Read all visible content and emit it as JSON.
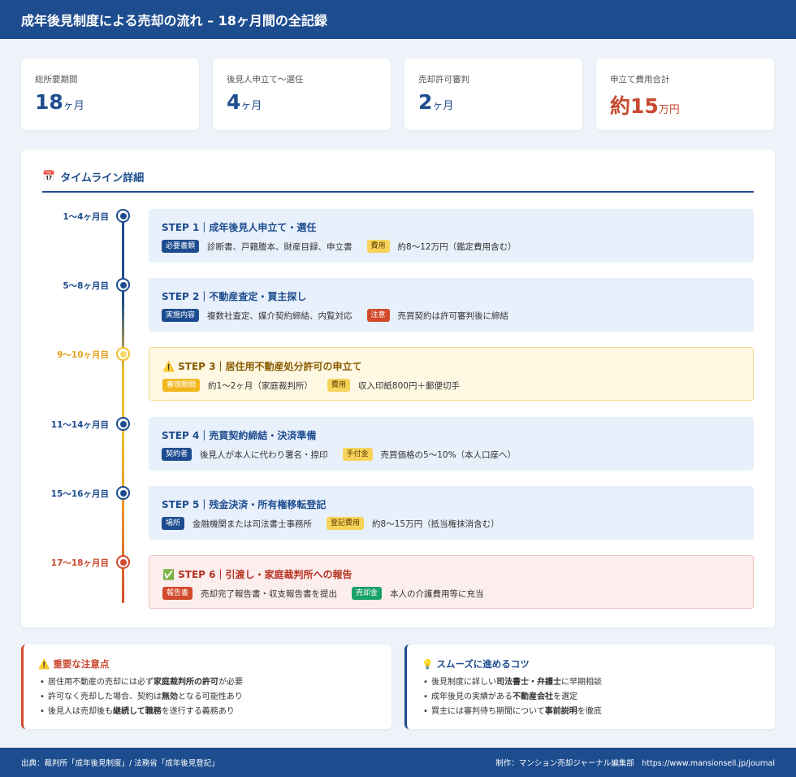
{
  "header": {
    "title": "成年後見制度による売却の流れ – 18ヶ月間の全記録"
  },
  "stats": [
    {
      "label": "総所要期間",
      "num": "18",
      "unit": "ヶ月"
    },
    {
      "label": "後見人申立て〜選任",
      "num": "4",
      "unit": "ヶ月"
    },
    {
      "label": "売却許可審判",
      "num": "2",
      "unit": "ヶ月"
    },
    {
      "label": "申立て費用合計",
      "num": "約15",
      "unit": "万円"
    }
  ],
  "timeline": {
    "icon": "📅",
    "title": "タイムライン詳細",
    "steps": [
      {
        "period": "1〜4ヶ月目",
        "title": "STEP 1｜成年後見人申立て・選任",
        "tag1": "必要書類",
        "text1": "診断書、戸籍謄本、財産目録、申立書",
        "tag2": "費用",
        "text2": "約8〜12万円（鑑定費用含む）"
      },
      {
        "period": "5〜8ヶ月目",
        "title": "STEP 2｜不動産査定・買主探し",
        "tag1": "実施内容",
        "text1": "複数社査定、媒介契約締結、内覧対応",
        "tag2": "注意",
        "text2": "売買契約は許可審判後に締結"
      },
      {
        "period": "9〜10ヶ月目",
        "title": "⚠️ STEP 3｜居住用不動産処分許可の申立て",
        "tag1": "審理期間",
        "text1": "約1〜2ヶ月（家庭裁判所）",
        "tag2": "費用",
        "text2": "収入印紙800円＋郵便切手"
      },
      {
        "period": "11〜14ヶ月目",
        "title": "STEP 4｜売買契約締結・決済準備",
        "tag1": "契約者",
        "text1": "後見人が本人に代わり署名・捺印",
        "tag2": "手付金",
        "text2": "売買価格の5〜10%（本人口座へ）"
      },
      {
        "period": "15〜16ヶ月目",
        "title": "STEP 5｜残金決済・所有権移転登記",
        "tag1": "場所",
        "text1": "金融機関または司法書士事務所",
        "tag2": "登記費用",
        "text2": "約8〜15万円（抵当権抹消含む）"
      },
      {
        "period": "17〜18ヶ月目",
        "title": "✅ STEP 6｜引渡し・家庭裁判所への報告",
        "tag1": "報告書",
        "text1": "売却完了報告書・収支報告書を提出",
        "tag2": "売却金",
        "text2": "本人の介護費用等に充当"
      }
    ]
  },
  "notes": {
    "caution": {
      "title": "⚠️ 重要な注意点",
      "items": [
        {
          "a": "居住用不動産の売却には必ず",
          "b": "家庭裁判所の許可",
          "c": "が必要"
        },
        {
          "a": "許可なく売却した場合、契約は",
          "b": "無効",
          "c": "となる可能性あり"
        },
        {
          "a": "後見人は売却後も",
          "b": "継続して職務",
          "c": "を遂行する義務あり"
        }
      ]
    },
    "tips": {
      "title": "💡 スムーズに進めるコツ",
      "items": [
        {
          "a": "後見制度に詳しい",
          "b": "司法書士・弁護士",
          "c": "に早期相談"
        },
        {
          "a": "成年後見の実績がある",
          "b": "不動産会社",
          "c": "を選定"
        },
        {
          "a": "買主には審判待ち期間について",
          "b": "事前説明",
          "c": "を徹底"
        }
      ]
    }
  },
  "footer": {
    "source": "出典：裁判所「成年後見制度」/ 法務省「成年後見登記」",
    "credit": "制作：マンション売却ジャーナル編集部　https://www.mansionsell.jp/journal"
  },
  "colors": {
    "primary": "#1e4d8f",
    "accent_red": "#c9482e",
    "accent_yellow": "#f2c12e"
  }
}
